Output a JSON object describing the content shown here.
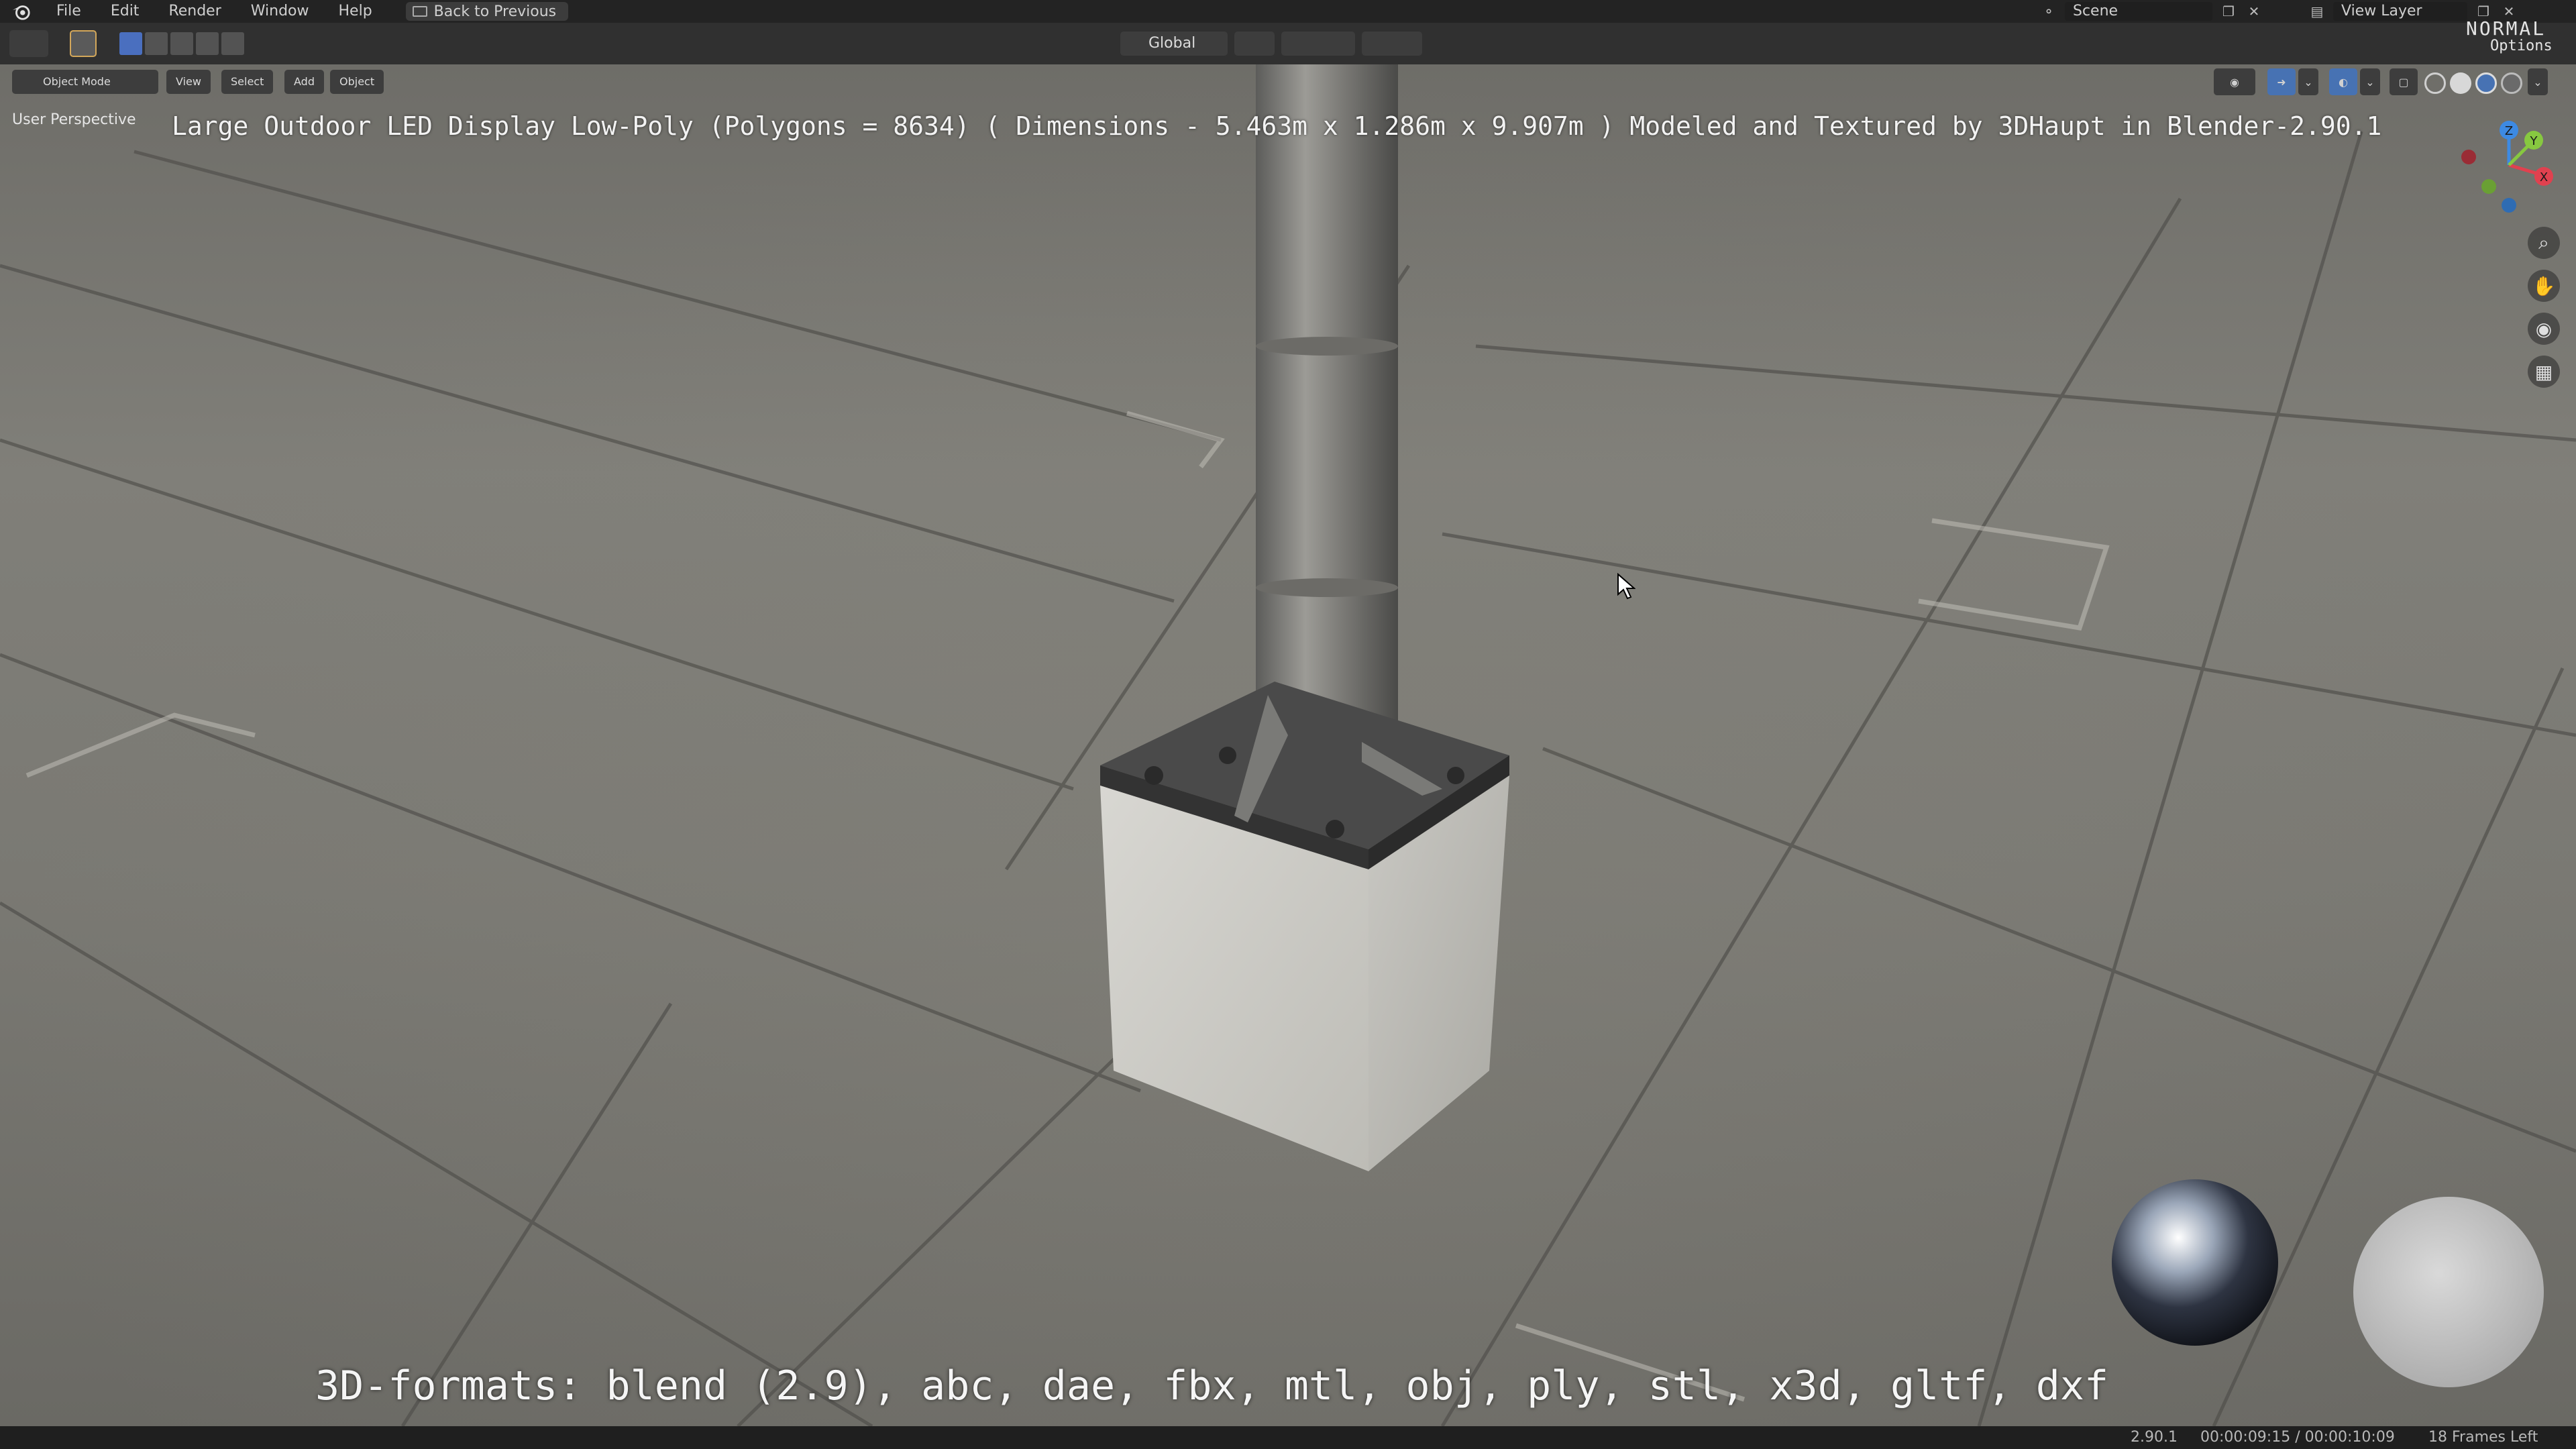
{
  "app": {
    "name": "Blender"
  },
  "topbar": {
    "menus": [
      "File",
      "Edit",
      "Render",
      "Window",
      "Help"
    ],
    "back_button": "Back to Previous",
    "scene_label": "Scene",
    "view_layer_label": "View Layer"
  },
  "header": {
    "options_label": "Options",
    "transform_orientation": "Global",
    "mode_selector": "Object Mode",
    "view_menu": "View",
    "select_menu": "Select",
    "add_menu": "Add",
    "object_menu": "Object"
  },
  "viewport": {
    "perspective_label": "User Perspective",
    "model_caption": "Large Outdoor LED Display Low-Poly (Polygons = 8634) ( Dimensions -  5.463m x 1.286m x 9.907m ) Modeled and Textured by 3DHaupt in Blender-2.90.1",
    "formats_caption": "3D-formats: blend (2.9), abc, dae, fbx, mtl, obj, ply, stl, x3d, gltf, dxf",
    "overlay_watermark": "NORMAL",
    "axes": {
      "x": "X",
      "y": "Y",
      "z": "Z"
    }
  },
  "statusbar": {
    "version": "2.90.1",
    "time": "00:00:09:15 / 00:00:10:09",
    "frames_left": "18 Frames Left"
  },
  "colors": {
    "accent_blue": "#4772b3",
    "axis_x": "#e0414f",
    "axis_y": "#87c840",
    "axis_z": "#3d8ae3"
  }
}
